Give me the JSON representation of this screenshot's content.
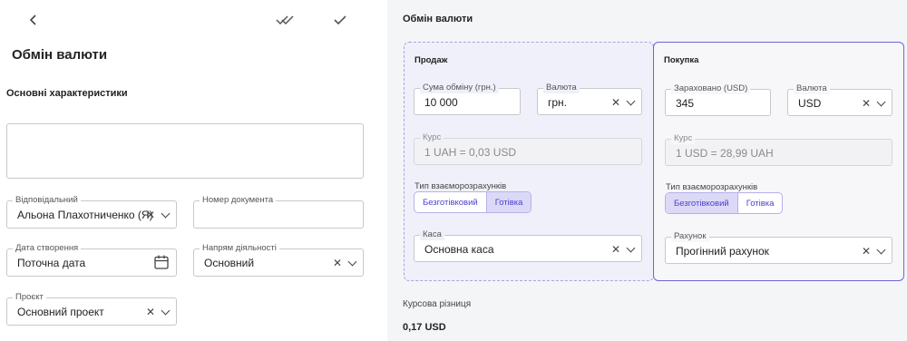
{
  "left": {
    "title": "Обмін валюти",
    "section_title": "Основні характеристики",
    "responsible": {
      "label": "Відповідальний",
      "value": "Альона Плахотниченко (Я)"
    },
    "doc_number": {
      "label": "Номер документа",
      "value": ""
    },
    "created_date": {
      "label": "Дата створення",
      "value": "Поточна дата"
    },
    "activity": {
      "label": "Напрям діяльності",
      "value": "Основний"
    },
    "project": {
      "label": "Проєкт",
      "value": "Основний проект"
    }
  },
  "right": {
    "title": "Обмін валюти",
    "sell": {
      "title": "Продаж",
      "amount": {
        "label": "Сума обміну (грн.)",
        "value": "10 000"
      },
      "currency": {
        "label": "Валюта",
        "value": "грн."
      },
      "rate": {
        "label": "Курс",
        "value": "1 UAH = 0,03 USD"
      },
      "settlement": {
        "label": "Тип взаєморозрахунків",
        "options": [
          "Безготівковий",
          "Готівка"
        ],
        "selected": "Готівка"
      },
      "cashbox": {
        "label": "Каса",
        "value": "Основна каса"
      }
    },
    "buy": {
      "title": "Покупка",
      "credited": {
        "label": "Зараховано (USD)",
        "value": "345"
      },
      "currency": {
        "label": "Валюта",
        "value": "USD"
      },
      "rate": {
        "label": "Курс",
        "value": "1 USD = 28,99 UAH"
      },
      "settlement": {
        "label": "Тип взаєморозрахунків",
        "options": [
          "Безготівковий",
          "Готівка"
        ],
        "selected": "Безготівковий"
      },
      "account": {
        "label": "Рахунок",
        "value": "Прогінний рахунок"
      }
    },
    "diff_label": "Курсова різниця",
    "diff_value": "0,17 USD"
  },
  "icons": {
    "back": "chevron-left-icon",
    "double_check": "double-check-icon",
    "check": "check-icon",
    "calendar": "calendar-icon",
    "clear": "clear-icon",
    "dropdown": "chevron-down-icon"
  },
  "colors": {
    "accent": "#6f63d8",
    "sell_bg": "#f0f0fb",
    "right_bg": "#f4f5f7"
  }
}
